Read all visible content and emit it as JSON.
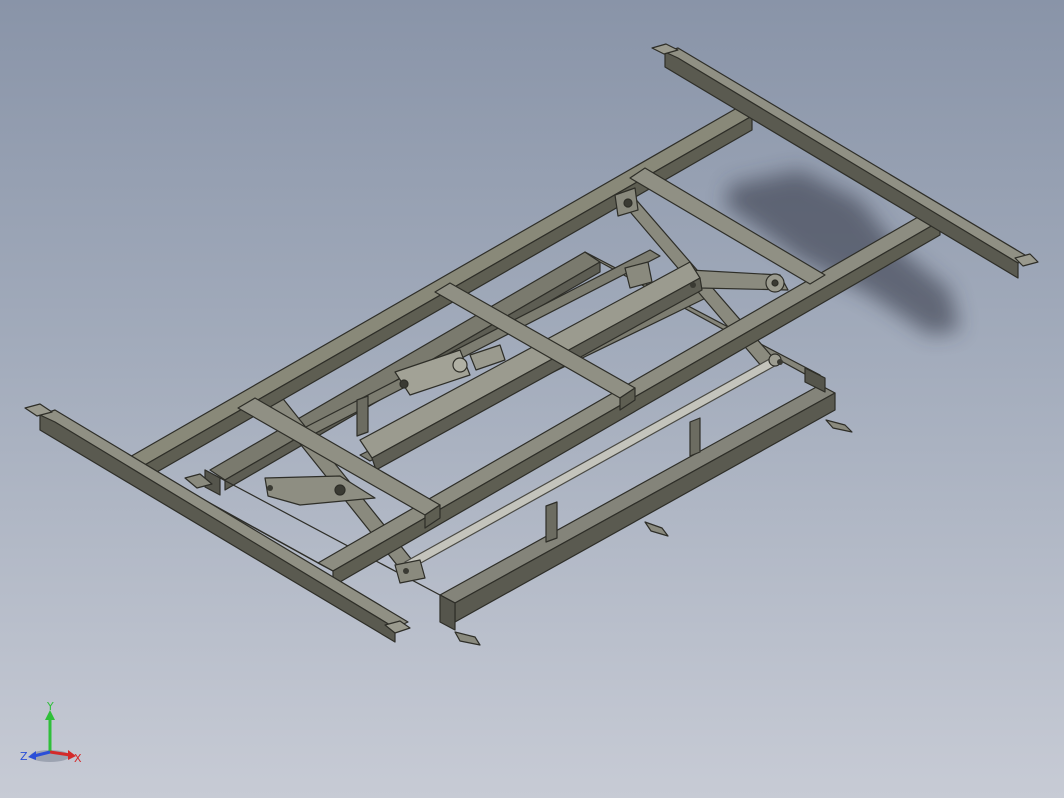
{
  "viewport": {
    "background_top": "#8994a8",
    "background_bottom": "#c7cbd5",
    "model_color": "#77776b",
    "model_edge_color": "#2e2e28"
  },
  "triad": {
    "x_label": "X",
    "y_label": "Y",
    "z_label": "Z",
    "x_color": "#d42a2a",
    "y_color": "#2fbf3a",
    "z_color": "#2a4fd8"
  }
}
